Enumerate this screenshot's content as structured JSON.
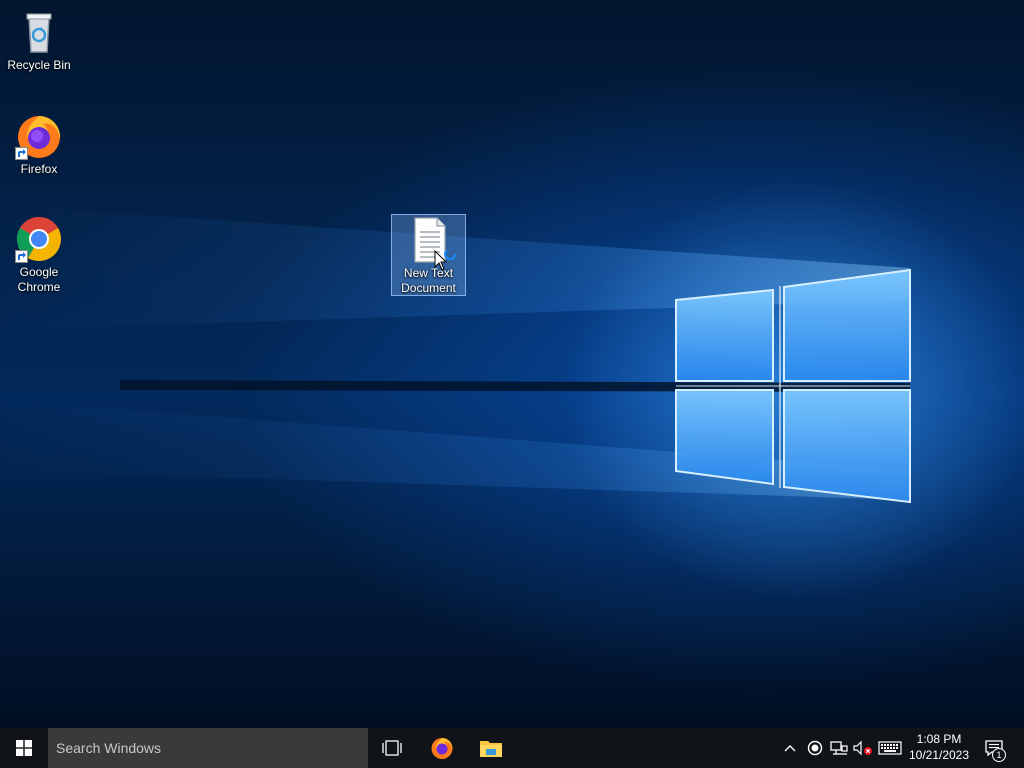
{
  "desktop": {
    "icons": [
      {
        "label": "Recycle Bin",
        "icon": "recycle-bin-icon"
      },
      {
        "label": "Firefox",
        "icon": "firefox-icon"
      },
      {
        "label": "Google Chrome",
        "icon": "chrome-icon"
      },
      {
        "label": "New Text Document",
        "icon": "text-document-icon",
        "selected": true
      }
    ]
  },
  "taskbar": {
    "start_icon": "windows-logo-icon",
    "search_placeholder": "Search Windows",
    "pinned": [
      {
        "icon": "task-view-icon"
      },
      {
        "icon": "firefox-icon"
      },
      {
        "icon": "file-explorer-icon"
      }
    ],
    "tray": {
      "icons": [
        "chevron-up-icon",
        "record-icon",
        "network-icon",
        "volume-muted-icon",
        "keyboard-icon"
      ],
      "time": "1:08 PM",
      "date": "10/21/2023",
      "notification_count": "1"
    }
  },
  "colors": {
    "taskbar_bg": "#101418",
    "search_bg": "#3a3a3a",
    "wallpaper_accent": "#3aa0ff"
  }
}
